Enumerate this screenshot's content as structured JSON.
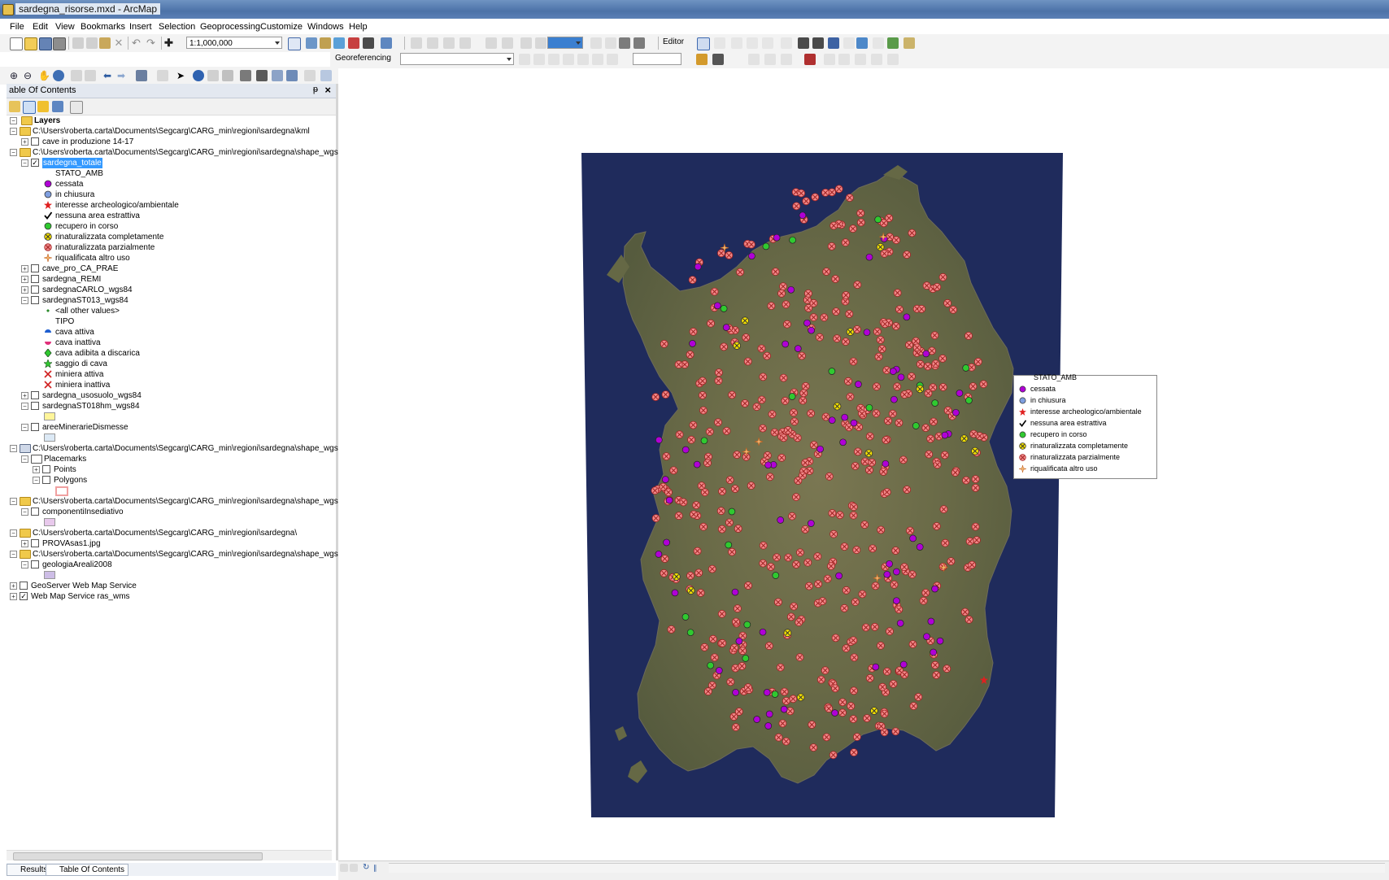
{
  "window": {
    "title": "sardegna_risorse.mxd - ArcMap"
  },
  "menu": [
    "File",
    "Edit",
    "View",
    "Bookmarks",
    "Insert",
    "Selection",
    "Geoprocessing",
    "Customize",
    "Windows",
    "Help"
  ],
  "toolbar": {
    "scale": "1:1,000,000",
    "editor_label": "Editor",
    "georeferencing_label": "Georeferencing",
    "layer_combo": ""
  },
  "toc": {
    "title": "able Of Contents",
    "pin": "ᵽ",
    "close": "×",
    "root": "Layers",
    "items": [
      {
        "label": "C:\\Users\\roberta.carta\\Documents\\Segcarg\\CARG_min\\regioni\\sardegna\\kml",
        "kind": "folder",
        "exp": "−",
        "check": null,
        "level": 1
      },
      {
        "label": "cave in produzione 14-17",
        "kind": "layer",
        "exp": "+",
        "check": false,
        "level": 2
      },
      {
        "label": "C:\\Users\\roberta.carta\\Documents\\Segcarg\\CARG_min\\regioni\\sardegna\\shape_wgs",
        "kind": "folder",
        "exp": "−",
        "check": null,
        "level": 1
      },
      {
        "label": "sardegna_totale",
        "kind": "layer",
        "exp": "−",
        "check": true,
        "level": 2,
        "selected": true
      },
      {
        "label": "STATO_AMB",
        "kind": "field",
        "level": 3
      },
      {
        "label": "cessata",
        "kind": "sym",
        "sym": "dot-purple",
        "level": 3
      },
      {
        "label": "in chiusura",
        "kind": "sym",
        "sym": "dot-blue",
        "level": 3
      },
      {
        "label": "interesse archeologico/ambientale",
        "kind": "sym",
        "sym": "star-red",
        "level": 3
      },
      {
        "label": "nessuna area estrattiva",
        "kind": "sym",
        "sym": "check",
        "level": 3
      },
      {
        "label": "recupero in corso",
        "kind": "sym",
        "sym": "dot-green",
        "level": 3
      },
      {
        "label": "rinaturalizzata completamente",
        "kind": "sym",
        "sym": "x-yellow",
        "level": 3
      },
      {
        "label": "rinaturalizzata parzialmente",
        "kind": "sym",
        "sym": "x-red",
        "level": 3
      },
      {
        "label": "riqualificata altro uso",
        "kind": "sym",
        "sym": "cross-orange",
        "level": 3
      },
      {
        "label": "cave_pro_CA_PRAE",
        "kind": "layer",
        "exp": "+",
        "check": false,
        "level": 2
      },
      {
        "label": "sardegna_REMI",
        "kind": "layer",
        "exp": "+",
        "check": false,
        "level": 2
      },
      {
        "label": "sardegnaCARLO_wgs84",
        "kind": "layer",
        "exp": "+",
        "check": false,
        "level": 2
      },
      {
        "label": "sardegnaST013_wgs84",
        "kind": "layer",
        "exp": "−",
        "check": false,
        "level": 2
      },
      {
        "label": "<all other values>",
        "kind": "sym",
        "sym": "diamond-small",
        "level": 3
      },
      {
        "label": "TIPO",
        "kind": "field",
        "level": 3
      },
      {
        "label": "cava attiva",
        "kind": "sym",
        "sym": "half-blue",
        "level": 3
      },
      {
        "label": "cava inattiva",
        "kind": "sym",
        "sym": "half-pink",
        "level": 3
      },
      {
        "label": "cava adibita a discarica",
        "kind": "sym",
        "sym": "diamond-green",
        "level": 3
      },
      {
        "label": "saggio di cava",
        "kind": "sym",
        "sym": "star-green",
        "level": 3
      },
      {
        "label": "miniera attiva",
        "kind": "sym",
        "sym": "pick-red",
        "level": 3
      },
      {
        "label": "miniera inattiva",
        "kind": "sym",
        "sym": "pick-red",
        "level": 3
      },
      {
        "label": "sardegna_usosuolo_wgs84",
        "kind": "layer",
        "exp": "+",
        "check": false,
        "level": 2
      },
      {
        "label": "sardegnaST018hm_wgs84",
        "kind": "layer",
        "exp": "−",
        "check": false,
        "level": 2
      },
      {
        "label": "",
        "kind": "patch",
        "color": "#fff59a",
        "level": 3
      },
      {
        "label": "areeMinerarieDismesse",
        "kind": "layer",
        "exp": "−",
        "check": false,
        "level": 2
      },
      {
        "label": "",
        "kind": "patch",
        "color": "#dce9f5",
        "level": 3
      },
      {
        "label": "C:\\Users\\roberta.carta\\Documents\\Segcarg\\CARG_min\\regioni\\sardegna\\shape_wgs",
        "kind": "folder-db",
        "exp": "−",
        "check": null,
        "level": 1
      },
      {
        "label": "Placemarks",
        "kind": "group",
        "exp": "−",
        "check": null,
        "level": 2
      },
      {
        "label": "Points",
        "kind": "layer",
        "exp": "+",
        "check": false,
        "level": 3
      },
      {
        "label": "Polygons",
        "kind": "layer",
        "exp": "−",
        "check": false,
        "level": 3
      },
      {
        "label": "",
        "kind": "patch-outline",
        "color": "#f0a0a0",
        "level": 4
      },
      {
        "label": "C:\\Users\\roberta.carta\\Documents\\Segcarg\\CARG_min\\regioni\\sardegna\\shape_wgs",
        "kind": "folder",
        "exp": "−",
        "check": null,
        "level": 1
      },
      {
        "label": "componentiInsediativo",
        "kind": "layer",
        "exp": "−",
        "check": false,
        "level": 2
      },
      {
        "label": "",
        "kind": "patch",
        "color": "#e8c9ec",
        "level": 3
      },
      {
        "label": "C:\\Users\\roberta.carta\\Documents\\Segcarg\\CARG_min\\regioni\\sardegna\\",
        "kind": "folder",
        "exp": "−",
        "check": null,
        "level": 1
      },
      {
        "label": "PROVAsas1.jpg",
        "kind": "layer",
        "exp": "+",
        "check": false,
        "level": 2
      },
      {
        "label": "C:\\Users\\roberta.carta\\Documents\\Segcarg\\CARG_min\\regioni\\sardegna\\shape_wgs",
        "kind": "folder",
        "exp": "−",
        "check": null,
        "level": 1
      },
      {
        "label": "geologiaAreali2008",
        "kind": "layer",
        "exp": "−",
        "check": false,
        "level": 2
      },
      {
        "label": "",
        "kind": "patch",
        "color": "#cdbde6",
        "level": 3
      },
      {
        "label": "GeoServer Web Map Service",
        "kind": "layer",
        "exp": "+",
        "check": false,
        "level": 1
      },
      {
        "label": "Web Map Service ras_wms",
        "kind": "layer",
        "exp": "+",
        "check": true,
        "level": 1
      }
    ]
  },
  "bottom_tabs": [
    "Results",
    "Table Of Contents"
  ],
  "legend": {
    "title": "STATO_AMB",
    "items": [
      {
        "label": "cessata",
        "sym": "dot-purple"
      },
      {
        "label": "in chiusura",
        "sym": "dot-blue"
      },
      {
        "label": "interesse archeologico/ambientale",
        "sym": "star-red"
      },
      {
        "label": "nessuna area estrattiva",
        "sym": "check"
      },
      {
        "label": "recupero in corso",
        "sym": "dot-green"
      },
      {
        "label": "rinaturalizzata completamente",
        "sym": "x-yellow"
      },
      {
        "label": "rinaturalizzata parzialmente",
        "sym": "x-red"
      },
      {
        "label": "riqualificata altro uso",
        "sym": "cross-orange"
      }
    ]
  },
  "colors": {
    "selection": "#3399ff",
    "sea": "#1e2a5a",
    "land": "#6b6b4a",
    "cessata": "#b000d6",
    "in_chiusura": "#6f8fd8",
    "recupero": "#30c930",
    "rinat_compl": "#f3e000",
    "rinat_parz": "#f08888"
  }
}
